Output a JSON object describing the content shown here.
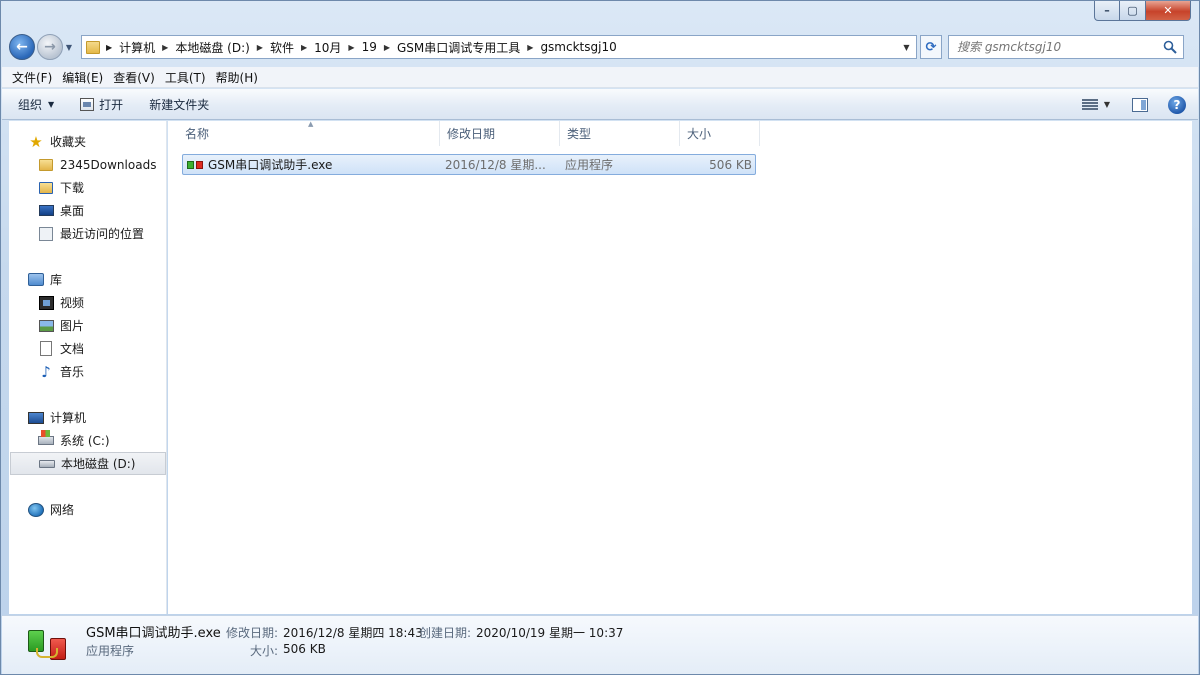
{
  "address": {
    "crumbs": [
      "计算机",
      "本地磁盘 (D:)",
      "软件",
      "10月",
      "19",
      "GSM串口调试专用工具",
      "gsmcktsgj10"
    ]
  },
  "search": {
    "placeholder": "搜索 gsmcktsgj10"
  },
  "menubar": [
    "文件(F)",
    "编辑(E)",
    "查看(V)",
    "工具(T)",
    "帮助(H)"
  ],
  "toolbar": {
    "organize": "组织",
    "open": "打开",
    "new_folder": "新建文件夹"
  },
  "navpane": {
    "favorites": {
      "label": "收藏夹",
      "items": [
        "2345Downloads",
        "下载",
        "桌面",
        "最近访问的位置"
      ]
    },
    "libraries": {
      "label": "库",
      "items": [
        "视频",
        "图片",
        "文档",
        "音乐"
      ]
    },
    "computer": {
      "label": "计算机",
      "items": [
        "系统 (C:)",
        "本地磁盘 (D:)"
      ],
      "selected": "本地磁盘 (D:)"
    },
    "network": {
      "label": "网络"
    }
  },
  "columns": [
    "名称",
    "修改日期",
    "类型",
    "大小"
  ],
  "files": [
    {
      "name": "GSM串口调试助手.exe",
      "modified": "2016/12/8 星期...",
      "type": "应用程序",
      "size": "506 KB"
    }
  ],
  "details": {
    "name": "GSM串口调试助手.exe",
    "type": "应用程序",
    "modified_label": "修改日期:",
    "modified": "2016/12/8 星期四 18:43",
    "created_label": "创建日期:",
    "created": "2020/10/19 星期一 10:37",
    "size_label": "大小:",
    "size": "506 KB"
  }
}
